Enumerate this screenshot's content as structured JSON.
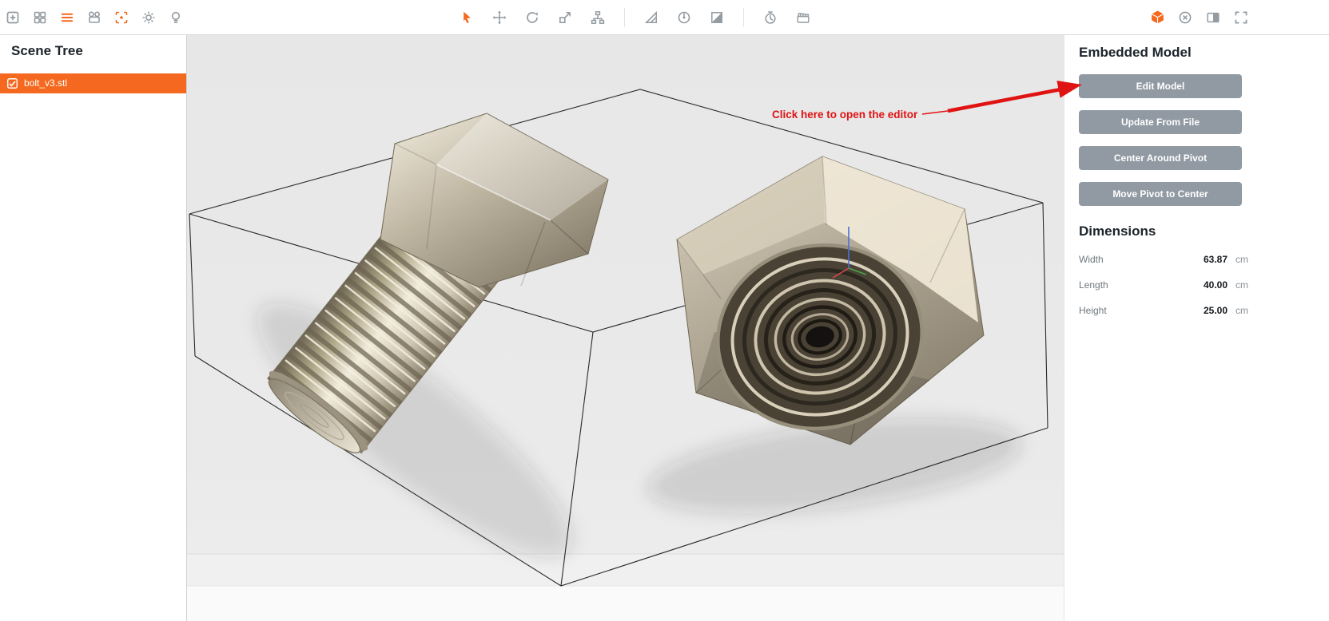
{
  "colors": {
    "accent": "#f4691f",
    "toolbar_icon_gray": "#939ba1",
    "button_bg": "#919aa3",
    "annotation_red": "#e01313",
    "selection_bg": "#f4691f"
  },
  "toolbar": {
    "left_icons": [
      "add-square-icon",
      "layout-grid-icon",
      "menu-icon",
      "movie-camera-icon",
      "focus-target-icon",
      "gear-icon",
      "lightbulb-icon"
    ],
    "center_icons": [
      "cursor-select-icon",
      "move-icon",
      "rotate-icon",
      "scale-icon",
      "hierarchy-icon",
      "ruler-icon",
      "measure-angle-icon",
      "shaded-view-icon",
      "timer-icon",
      "clapperboard-icon"
    ],
    "right_icons": [
      "model-cube-icon",
      "remove-circle-icon",
      "panel-toggle-icon",
      "fullscreen-icon"
    ]
  },
  "scene_tree": {
    "title": "Scene Tree",
    "items": [
      {
        "label": "bolt_v3.stl",
        "selected": true,
        "checked": true
      }
    ]
  },
  "annotation": {
    "text": "Click here to open the editor"
  },
  "right_panel": {
    "title": "Embedded Model",
    "buttons": [
      {
        "label": "Edit Model"
      },
      {
        "label": "Update From File"
      },
      {
        "label": "Center Around Pivot"
      },
      {
        "label": "Move Pivot to Center"
      }
    ],
    "dimensions": {
      "title": "Dimensions",
      "rows": [
        {
          "label": "Width",
          "value": "63.87",
          "unit": "cm"
        },
        {
          "label": "Length",
          "value": "40.00",
          "unit": "cm"
        },
        {
          "label": "Height",
          "value": "25.00",
          "unit": "cm"
        }
      ]
    }
  }
}
